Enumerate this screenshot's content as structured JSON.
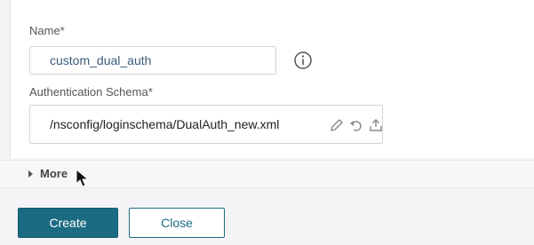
{
  "form": {
    "name_label": "Name*",
    "name_value": "custom_dual_auth",
    "schema_label": "Authentication Schema*",
    "schema_value": "/nsconfig/loginschema/DualAuth_new.xml",
    "more_label": "More"
  },
  "buttons": {
    "create": "Create",
    "close": "Close"
  },
  "icons": {
    "info": "info-icon",
    "edit": "pencil-icon",
    "undo": "undo-icon",
    "upload": "upload-icon"
  },
  "colors": {
    "primary": "#1b6b82",
    "input_text": "#3a5b7a"
  }
}
